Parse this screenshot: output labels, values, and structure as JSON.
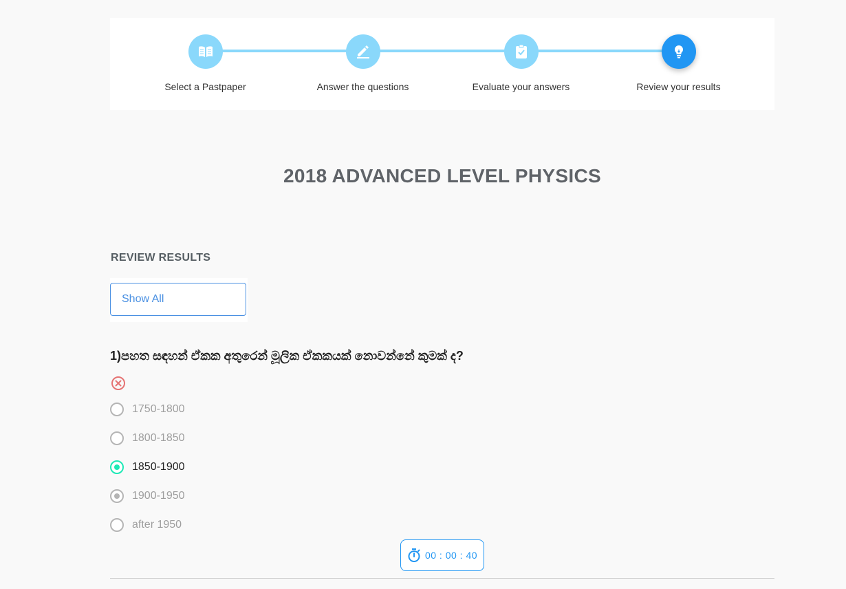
{
  "stepper": {
    "steps": [
      {
        "label": "Select a Pastpaper",
        "icon": "book-open-icon",
        "state": "done"
      },
      {
        "label": "Answer the questions",
        "icon": "pencil-icon",
        "state": "done"
      },
      {
        "label": "Evaluate your answers",
        "icon": "clipboard-check-icon",
        "state": "done"
      },
      {
        "label": "Review your results",
        "icon": "lightbulb-icon",
        "state": "active"
      }
    ],
    "colors": {
      "done": "#8ad8fb",
      "active": "#2196f3"
    }
  },
  "page": {
    "title": "2018 ADVANCED LEVEL PHYSICS",
    "section_title": "REVIEW RESULTS"
  },
  "filter": {
    "selected": "Show All"
  },
  "question": {
    "text": "1)පහත සඳහන් ඒකක අතුරෙන් මූලික ඒකකයක් නොවන්නේ කුමක් ද?",
    "result": "incorrect",
    "result_icon": "close-circle-icon",
    "options": [
      {
        "label": "1750-1800",
        "state": "unselected"
      },
      {
        "label": "1800-1850",
        "state": "unselected"
      },
      {
        "label": "1850-1900",
        "state": "correct"
      },
      {
        "label": "1900-1950",
        "state": "selected"
      },
      {
        "label": "after 1950",
        "state": "unselected"
      }
    ]
  },
  "timer": {
    "icon": "stopwatch-icon",
    "value": "00 : 00 : 40"
  }
}
